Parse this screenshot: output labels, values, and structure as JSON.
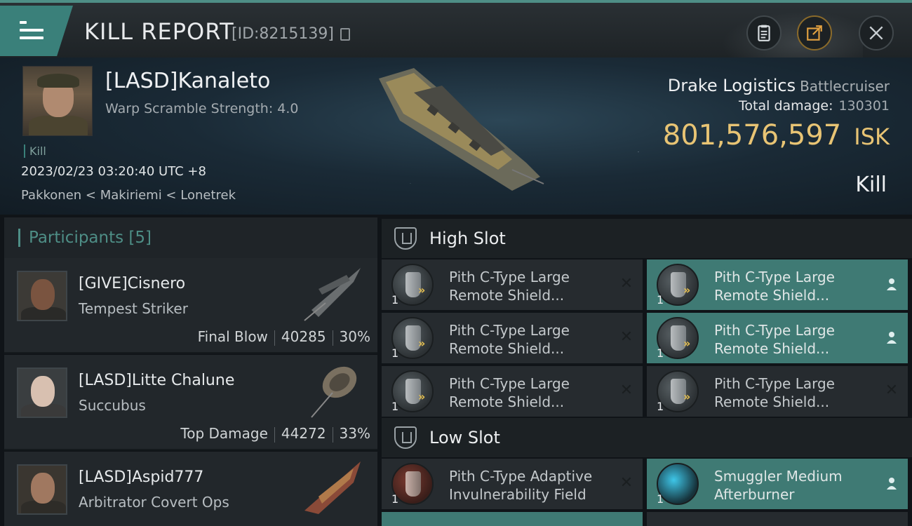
{
  "header": {
    "title": "KILL REPORT",
    "kill_id": "[ID:8215139]"
  },
  "victim": {
    "name": "[LASD]Kanaleto",
    "warp_scramble": "Warp Scramble Strength: 4.0",
    "tag": "Kill",
    "datetime": "2023/02/23 03:20:40 UTC +8",
    "location": "Pakkonen < Makiriemi < Lonetrek",
    "ship_name": "Drake Logistics",
    "ship_class": "Battlecruiser",
    "total_damage_label": "Total damage:",
    "total_damage": "130301",
    "isk_value": "801,576,597",
    "isk_unit": "ISK",
    "result": "Kill"
  },
  "participants": {
    "label": "Participants",
    "count": "[5]",
    "items": [
      {
        "name": "[GIVE]Cisnero",
        "ship": "Tempest Striker",
        "tag": "Final Blow",
        "damage": "40285",
        "percent": "30%"
      },
      {
        "name": "[LASD]Litte Chalune",
        "ship": "Succubus",
        "tag": "Top Damage",
        "damage": "44272",
        "percent": "33%"
      },
      {
        "name": "[LASD]Aspid777",
        "ship": "Arbitrator Covert Ops",
        "tag": "",
        "damage": "",
        "percent": ""
      }
    ]
  },
  "fitting": {
    "high_slot_label": "High Slot",
    "low_slot_label": "Low Slot",
    "high": [
      {
        "name_line1": "Pith C-Type Large",
        "name_line2": "Remote Shield...",
        "qty": "1",
        "state": "destroyed"
      },
      {
        "name_line1": "Pith C-Type Large",
        "name_line2": "Remote Shield...",
        "qty": "1",
        "state": "dropped"
      },
      {
        "name_line1": "Pith C-Type Large",
        "name_line2": "Remote Shield...",
        "qty": "1",
        "state": "destroyed"
      },
      {
        "name_line1": "Pith C-Type Large",
        "name_line2": "Remote Shield...",
        "qty": "1",
        "state": "dropped"
      },
      {
        "name_line1": "Pith C-Type Large",
        "name_line2": "Remote Shield...",
        "qty": "1",
        "state": "destroyed"
      },
      {
        "name_line1": "Pith C-Type Large",
        "name_line2": "Remote Shield...",
        "qty": "1",
        "state": "destroyed"
      }
    ],
    "low": [
      {
        "name_line1": "Pith C-Type Adaptive",
        "name_line2": "Invulnerability Field",
        "qty": "1",
        "state": "destroyed"
      },
      {
        "name_line1": "Smuggler Medium",
        "name_line2": "Afterburner",
        "qty": "1",
        "state": "dropped"
      }
    ]
  },
  "icons": {
    "menu": "hamburger-menu-icon",
    "copy": "copy-icon",
    "clipboard": "clipboard-icon",
    "share": "share-icon",
    "close": "close-icon",
    "destroyed": "x-mark-icon",
    "dropped": "person-icon",
    "slot": "slot-shield-icon"
  },
  "colors": {
    "accent": "#4e8e86",
    "isk": "#e8c474",
    "dropped_bg": "#3f7a74",
    "destroyed_bg": "#262b2f"
  }
}
